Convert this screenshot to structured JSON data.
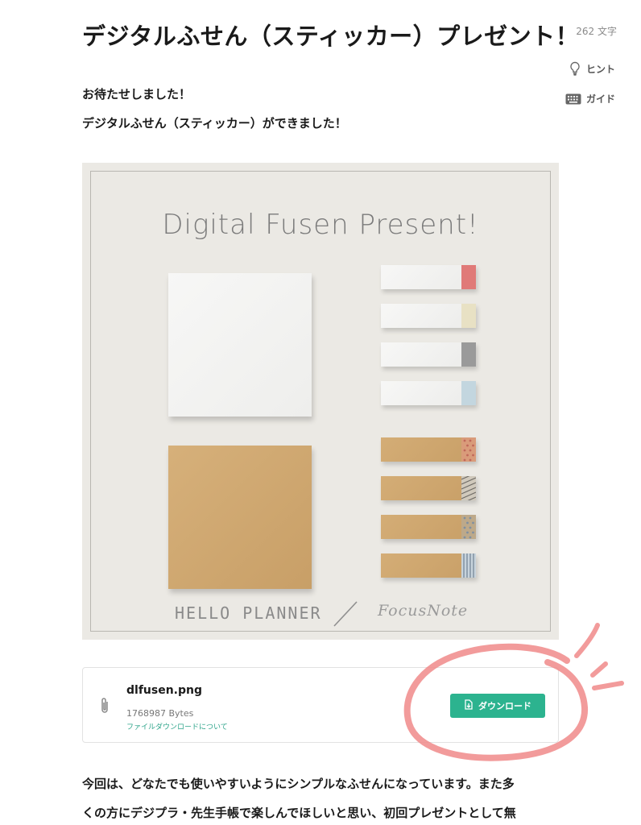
{
  "article": {
    "title": "デジタルふせん（スティッカー）プレゼント！",
    "intro_line1": "お待たせしました！",
    "intro_line2": "デジタルふせん（スティッカー）ができました！",
    "body_line1": "今回は、どなたでも使いやすいようにシンプルなふせんになっています。また多",
    "body_line2": "くの方にデジプラ・先生手帳で楽しんでほしいと思い、初回プレゼントとして無"
  },
  "sidebar": {
    "char_count": "262 文字",
    "hint_label": "ヒント",
    "guide_label": "ガイド"
  },
  "image": {
    "title": "Digital Fusen Present!",
    "footer_left": "HELLO PLANNER",
    "footer_right": "FocusNote",
    "strip_tab_colors": [
      "#e07a78",
      "#e8e1c4",
      "#9a9a9a",
      "#c3d6df"
    ]
  },
  "attachment": {
    "file_name": "dlfusen.png",
    "file_size": "1768987 Bytes",
    "help_link": "ファイルダウンロードについて",
    "download_label": "ダウンロード"
  },
  "colors": {
    "accent": "#2cb38f",
    "highlight": "#f08a8a"
  }
}
